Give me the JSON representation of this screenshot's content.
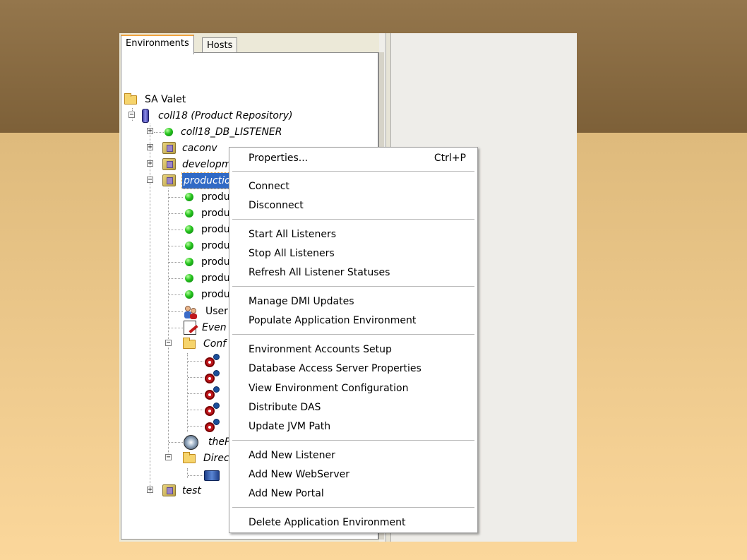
{
  "tabs": [
    "Environments",
    "Hosts"
  ],
  "tree": {
    "root": "SA Valet",
    "repository": "coll18 (Product Repository)",
    "listener": "coll18_DB_LISTENER",
    "env_caconv": "caconv",
    "env_development": "development",
    "env_production": "production",
    "prod_listeners": [
      "produ",
      "produ",
      "produ",
      "produ",
      "produ",
      "produ",
      "produ"
    ],
    "users": "User",
    "events": "Even",
    "config": "Conf",
    "config_items": [
      "",
      "",
      "",
      "",
      ""
    ],
    "web_item": "theP",
    "directory": "Direc",
    "env_test": "test"
  },
  "context_menu": {
    "groups": [
      [
        {
          "label": "Properties...",
          "shortcut": "Ctrl+P"
        }
      ],
      [
        {
          "label": "Connect"
        },
        {
          "label": "Disconnect"
        }
      ],
      [
        {
          "label": "Start All Listeners"
        },
        {
          "label": "Stop All Listeners"
        },
        {
          "label": "Refresh All Listener Statuses"
        }
      ],
      [
        {
          "label": "Manage DMI Updates"
        },
        {
          "label": "Populate Application Environment"
        }
      ],
      [
        {
          "label": "Environment Accounts Setup"
        },
        {
          "label": "Database Access Server Properties"
        },
        {
          "label": "View Environment Configuration"
        },
        {
          "label": "Distribute DAS"
        },
        {
          "label": "Update JVM Path"
        }
      ],
      [
        {
          "label": "Add New Listener"
        },
        {
          "label": "Add New WebServer"
        },
        {
          "label": "Add New Portal"
        }
      ],
      [
        {
          "label": "Delete Application Environment"
        }
      ]
    ]
  }
}
